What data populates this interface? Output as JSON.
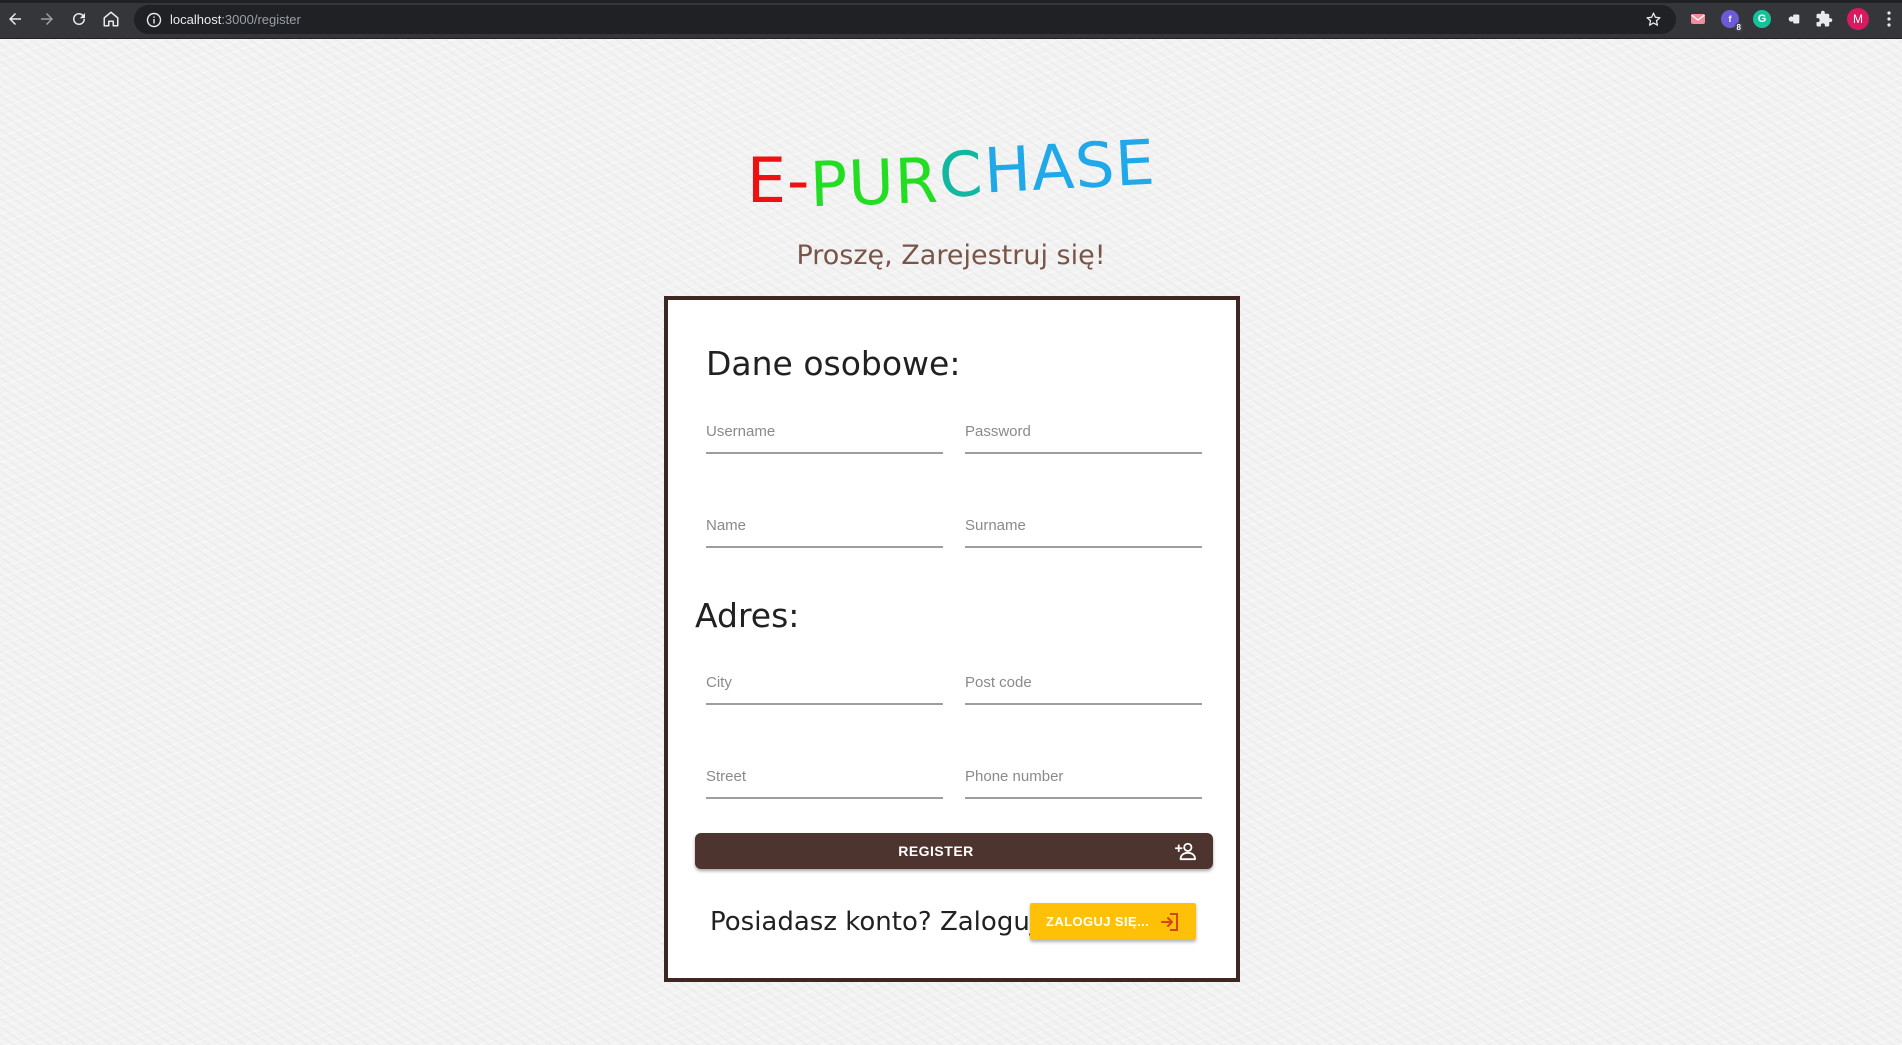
{
  "browser": {
    "url_host": "localhost",
    "url_path": ":3000/register",
    "profile_initial": "M",
    "extension_badge": "8",
    "grammarly_initial": "G"
  },
  "logo": {
    "part_e": "E",
    "part_dash": "-",
    "part_pur": "PUR",
    "part_c": "C",
    "part_hase": "HASE",
    "colors": {
      "e": "#ee1111",
      "dash": "#ee1111",
      "pur": "#22dd22",
      "c": "#11b8a0",
      "hase": "#20a8e8"
    }
  },
  "subtitle": "Proszę, Zarejestruj się!",
  "form": {
    "personal_heading": "Dane osobowe:",
    "address_heading": "Adres:",
    "username_placeholder": "Username",
    "password_placeholder": "Password",
    "name_placeholder": "Name",
    "surname_placeholder": "Surname",
    "city_placeholder": "City",
    "postcode_placeholder": "Post code",
    "street_placeholder": "Street",
    "phone_placeholder": "Phone number",
    "register_label": "REGISTER",
    "login_prompt": "Posiadasz konto? Zaloguj sie",
    "login_label": "ZALOGUJ SIĘ..."
  },
  "colors": {
    "card_border": "#3e2723",
    "register_button": "#4e342e",
    "login_button": "#ffc107",
    "subtitle": "#795548"
  }
}
